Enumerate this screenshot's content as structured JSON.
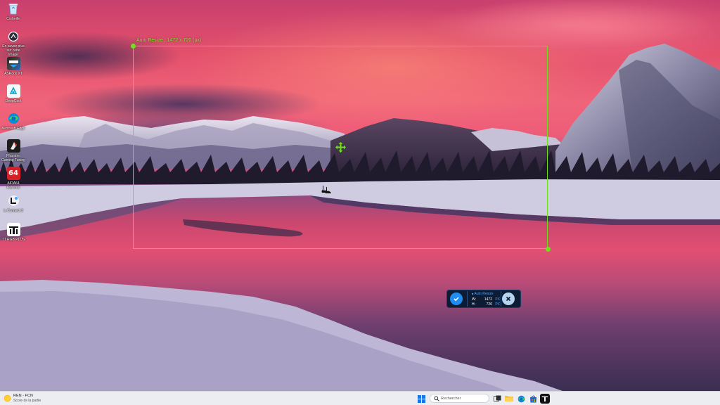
{
  "desktop": {
    "icons": [
      {
        "label": "Corbeille",
        "icon": "recycle-bin-icon"
      },
      {
        "label": "En savoir plus sur cette image",
        "icon": "info-icon"
      },
      {
        "label": "ASRock XT",
        "icon": "asrock-icon"
      },
      {
        "label": "DeepCool",
        "icon": "deepcool-icon"
      },
      {
        "label": "Microsoft Edge",
        "icon": "edge-icon"
      },
      {
        "label": "Phantom Gaming Tuning",
        "icon": "phantom-gaming-icon"
      },
      {
        "label": "AIDA64 Extreme",
        "icon": "aida64-icon"
      },
      {
        "label": "L-Connect 3",
        "icon": "lconnect-icon"
      },
      {
        "label": "TT RGB PLUS",
        "icon": "tt-rgb-icon"
      }
    ],
    "aida_badge": "64"
  },
  "capture": {
    "region_label": "Auto Resize : 1472 x 720 (px)",
    "accent_color": "#6fe01c"
  },
  "resize_panel": {
    "title": "Auto Resize",
    "width_label": "W:",
    "width_value": "1472",
    "height_label": "H:",
    "height_value": "720",
    "unit": "PX",
    "confirm_icon": "check-icon",
    "cancel_icon": "close-icon"
  },
  "taskbar": {
    "weather_title": "REN - FCN",
    "weather_subtitle": "Score de la partie",
    "search_placeholder": "Rechercher",
    "apps": [
      "windows-start-icon",
      "search-icon",
      "task-view-icon",
      "file-explorer-icon",
      "edge-icon",
      "store-icon",
      "tt-rgb-icon"
    ]
  }
}
